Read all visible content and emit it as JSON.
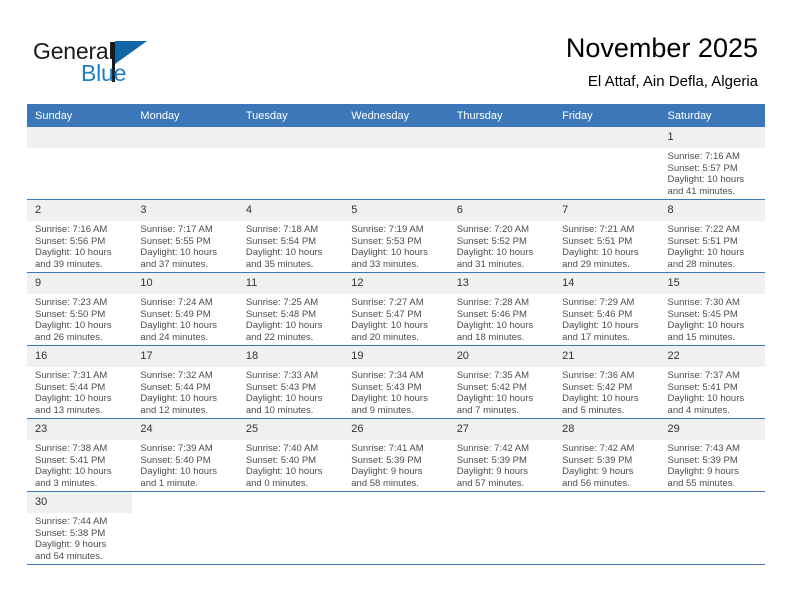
{
  "brand": {
    "name_primary": "General",
    "name_secondary": "Blue",
    "flag_color": "#1166a8",
    "accent_color": "#3c78b9"
  },
  "header": {
    "title": "November 2025",
    "subtitle": "El Attaf, Ain Defla, Algeria"
  },
  "weekday_headers": [
    "Sunday",
    "Monday",
    "Tuesday",
    "Wednesday",
    "Thursday",
    "Friday",
    "Saturday"
  ],
  "labels": {
    "sunrise_prefix": "Sunrise:",
    "sunset_prefix": "Sunset:",
    "daylight_prefix": "Daylight:"
  },
  "weeks": [
    [
      {
        "day": "",
        "sunrise": "",
        "sunset": "",
        "daylight_line1": "",
        "daylight_line2": "",
        "empty": true
      },
      {
        "day": "",
        "sunrise": "",
        "sunset": "",
        "daylight_line1": "",
        "daylight_line2": "",
        "empty": true
      },
      {
        "day": "",
        "sunrise": "",
        "sunset": "",
        "daylight_line1": "",
        "daylight_line2": "",
        "empty": true
      },
      {
        "day": "",
        "sunrise": "",
        "sunset": "",
        "daylight_line1": "",
        "daylight_line2": "",
        "empty": true
      },
      {
        "day": "",
        "sunrise": "",
        "sunset": "",
        "daylight_line1": "",
        "daylight_line2": "",
        "empty": true
      },
      {
        "day": "",
        "sunrise": "",
        "sunset": "",
        "daylight_line1": "",
        "daylight_line2": "",
        "empty": true
      },
      {
        "day": "1",
        "sunrise": "Sunrise: 7:16 AM",
        "sunset": "Sunset: 5:57 PM",
        "daylight_line1": "Daylight: 10 hours",
        "daylight_line2": "and 41 minutes.",
        "empty": false
      }
    ],
    [
      {
        "day": "2",
        "sunrise": "Sunrise: 7:16 AM",
        "sunset": "Sunset: 5:56 PM",
        "daylight_line1": "Daylight: 10 hours",
        "daylight_line2": "and 39 minutes.",
        "empty": false
      },
      {
        "day": "3",
        "sunrise": "Sunrise: 7:17 AM",
        "sunset": "Sunset: 5:55 PM",
        "daylight_line1": "Daylight: 10 hours",
        "daylight_line2": "and 37 minutes.",
        "empty": false
      },
      {
        "day": "4",
        "sunrise": "Sunrise: 7:18 AM",
        "sunset": "Sunset: 5:54 PM",
        "daylight_line1": "Daylight: 10 hours",
        "daylight_line2": "and 35 minutes.",
        "empty": false
      },
      {
        "day": "5",
        "sunrise": "Sunrise: 7:19 AM",
        "sunset": "Sunset: 5:53 PM",
        "daylight_line1": "Daylight: 10 hours",
        "daylight_line2": "and 33 minutes.",
        "empty": false
      },
      {
        "day": "6",
        "sunrise": "Sunrise: 7:20 AM",
        "sunset": "Sunset: 5:52 PM",
        "daylight_line1": "Daylight: 10 hours",
        "daylight_line2": "and 31 minutes.",
        "empty": false
      },
      {
        "day": "7",
        "sunrise": "Sunrise: 7:21 AM",
        "sunset": "Sunset: 5:51 PM",
        "daylight_line1": "Daylight: 10 hours",
        "daylight_line2": "and 29 minutes.",
        "empty": false
      },
      {
        "day": "8",
        "sunrise": "Sunrise: 7:22 AM",
        "sunset": "Sunset: 5:51 PM",
        "daylight_line1": "Daylight: 10 hours",
        "daylight_line2": "and 28 minutes.",
        "empty": false
      }
    ],
    [
      {
        "day": "9",
        "sunrise": "Sunrise: 7:23 AM",
        "sunset": "Sunset: 5:50 PM",
        "daylight_line1": "Daylight: 10 hours",
        "daylight_line2": "and 26 minutes.",
        "empty": false
      },
      {
        "day": "10",
        "sunrise": "Sunrise: 7:24 AM",
        "sunset": "Sunset: 5:49 PM",
        "daylight_line1": "Daylight: 10 hours",
        "daylight_line2": "and 24 minutes.",
        "empty": false
      },
      {
        "day": "11",
        "sunrise": "Sunrise: 7:25 AM",
        "sunset": "Sunset: 5:48 PM",
        "daylight_line1": "Daylight: 10 hours",
        "daylight_line2": "and 22 minutes.",
        "empty": false
      },
      {
        "day": "12",
        "sunrise": "Sunrise: 7:27 AM",
        "sunset": "Sunset: 5:47 PM",
        "daylight_line1": "Daylight: 10 hours",
        "daylight_line2": "and 20 minutes.",
        "empty": false
      },
      {
        "day": "13",
        "sunrise": "Sunrise: 7:28 AM",
        "sunset": "Sunset: 5:46 PM",
        "daylight_line1": "Daylight: 10 hours",
        "daylight_line2": "and 18 minutes.",
        "empty": false
      },
      {
        "day": "14",
        "sunrise": "Sunrise: 7:29 AM",
        "sunset": "Sunset: 5:46 PM",
        "daylight_line1": "Daylight: 10 hours",
        "daylight_line2": "and 17 minutes.",
        "empty": false
      },
      {
        "day": "15",
        "sunrise": "Sunrise: 7:30 AM",
        "sunset": "Sunset: 5:45 PM",
        "daylight_line1": "Daylight: 10 hours",
        "daylight_line2": "and 15 minutes.",
        "empty": false
      }
    ],
    [
      {
        "day": "16",
        "sunrise": "Sunrise: 7:31 AM",
        "sunset": "Sunset: 5:44 PM",
        "daylight_line1": "Daylight: 10 hours",
        "daylight_line2": "and 13 minutes.",
        "empty": false
      },
      {
        "day": "17",
        "sunrise": "Sunrise: 7:32 AM",
        "sunset": "Sunset: 5:44 PM",
        "daylight_line1": "Daylight: 10 hours",
        "daylight_line2": "and 12 minutes.",
        "empty": false
      },
      {
        "day": "18",
        "sunrise": "Sunrise: 7:33 AM",
        "sunset": "Sunset: 5:43 PM",
        "daylight_line1": "Daylight: 10 hours",
        "daylight_line2": "and 10 minutes.",
        "empty": false
      },
      {
        "day": "19",
        "sunrise": "Sunrise: 7:34 AM",
        "sunset": "Sunset: 5:43 PM",
        "daylight_line1": "Daylight: 10 hours",
        "daylight_line2": "and 9 minutes.",
        "empty": false
      },
      {
        "day": "20",
        "sunrise": "Sunrise: 7:35 AM",
        "sunset": "Sunset: 5:42 PM",
        "daylight_line1": "Daylight: 10 hours",
        "daylight_line2": "and 7 minutes.",
        "empty": false
      },
      {
        "day": "21",
        "sunrise": "Sunrise: 7:36 AM",
        "sunset": "Sunset: 5:42 PM",
        "daylight_line1": "Daylight: 10 hours",
        "daylight_line2": "and 5 minutes.",
        "empty": false
      },
      {
        "day": "22",
        "sunrise": "Sunrise: 7:37 AM",
        "sunset": "Sunset: 5:41 PM",
        "daylight_line1": "Daylight: 10 hours",
        "daylight_line2": "and 4 minutes.",
        "empty": false
      }
    ],
    [
      {
        "day": "23",
        "sunrise": "Sunrise: 7:38 AM",
        "sunset": "Sunset: 5:41 PM",
        "daylight_line1": "Daylight: 10 hours",
        "daylight_line2": "and 3 minutes.",
        "empty": false
      },
      {
        "day": "24",
        "sunrise": "Sunrise: 7:39 AM",
        "sunset": "Sunset: 5:40 PM",
        "daylight_line1": "Daylight: 10 hours",
        "daylight_line2": "and 1 minute.",
        "empty": false
      },
      {
        "day": "25",
        "sunrise": "Sunrise: 7:40 AM",
        "sunset": "Sunset: 5:40 PM",
        "daylight_line1": "Daylight: 10 hours",
        "daylight_line2": "and 0 minutes.",
        "empty": false
      },
      {
        "day": "26",
        "sunrise": "Sunrise: 7:41 AM",
        "sunset": "Sunset: 5:39 PM",
        "daylight_line1": "Daylight: 9 hours",
        "daylight_line2": "and 58 minutes.",
        "empty": false
      },
      {
        "day": "27",
        "sunrise": "Sunrise: 7:42 AM",
        "sunset": "Sunset: 5:39 PM",
        "daylight_line1": "Daylight: 9 hours",
        "daylight_line2": "and 57 minutes.",
        "empty": false
      },
      {
        "day": "28",
        "sunrise": "Sunrise: 7:42 AM",
        "sunset": "Sunset: 5:39 PM",
        "daylight_line1": "Daylight: 9 hours",
        "daylight_line2": "and 56 minutes.",
        "empty": false
      },
      {
        "day": "29",
        "sunrise": "Sunrise: 7:43 AM",
        "sunset": "Sunset: 5:39 PM",
        "daylight_line1": "Daylight: 9 hours",
        "daylight_line2": "and 55 minutes.",
        "empty": false
      }
    ],
    [
      {
        "day": "30",
        "sunrise": "Sunrise: 7:44 AM",
        "sunset": "Sunset: 5:38 PM",
        "daylight_line1": "Daylight: 9 hours",
        "daylight_line2": "and 54 minutes.",
        "empty": false
      },
      {
        "day": "",
        "sunrise": "",
        "sunset": "",
        "daylight_line1": "",
        "daylight_line2": "",
        "empty": true
      },
      {
        "day": "",
        "sunrise": "",
        "sunset": "",
        "daylight_line1": "",
        "daylight_line2": "",
        "empty": true
      },
      {
        "day": "",
        "sunrise": "",
        "sunset": "",
        "daylight_line1": "",
        "daylight_line2": "",
        "empty": true
      },
      {
        "day": "",
        "sunrise": "",
        "sunset": "",
        "daylight_line1": "",
        "daylight_line2": "",
        "empty": true
      },
      {
        "day": "",
        "sunrise": "",
        "sunset": "",
        "daylight_line1": "",
        "daylight_line2": "",
        "empty": true
      },
      {
        "day": "",
        "sunrise": "",
        "sunset": "",
        "daylight_line1": "",
        "daylight_line2": "",
        "empty": true
      }
    ]
  ]
}
